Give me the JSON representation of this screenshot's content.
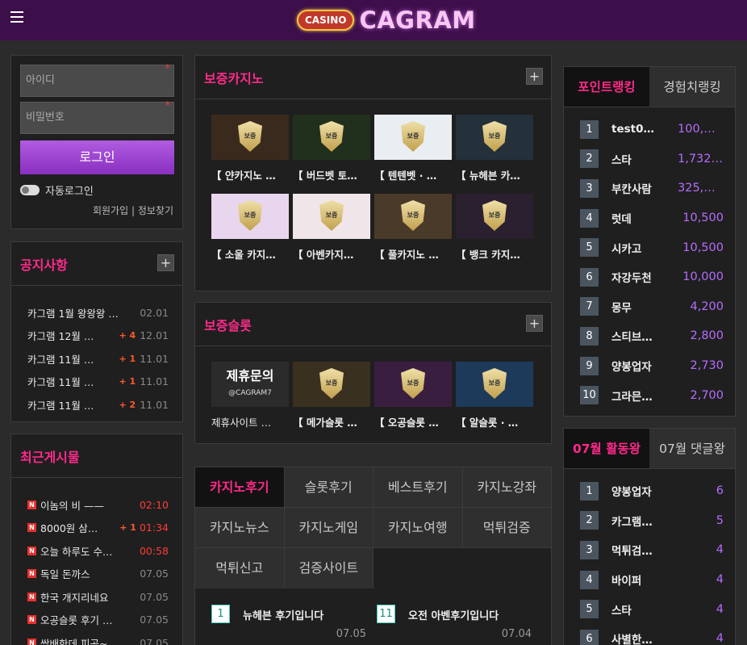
{
  "header": {
    "logo_badge": "CASINO",
    "logo_text": "CAGRAM"
  },
  "login": {
    "id_placeholder": "아이디",
    "pw_placeholder": "비밀번호",
    "required_mark": "*",
    "login_label": "로그인",
    "auto_login": "자동로그인",
    "signup": "회원가입",
    "separator": "|",
    "find_info": "정보찾기"
  },
  "notice": {
    "title": "공지사항",
    "plus": "+",
    "items": [
      {
        "title": "카그램 1월 왕왕왕 …",
        "count": "",
        "date": "02.01"
      },
      {
        "title": "카그램 12월 …",
        "count": "+ 4",
        "date": "12.01"
      },
      {
        "title": "카그램 11월 …",
        "count": "+ 1",
        "date": "11.01"
      },
      {
        "title": "카그램 11월 …",
        "count": "+ 1",
        "date": "11.01"
      },
      {
        "title": "카그램 11월 …",
        "count": "+ 2",
        "date": "11.01"
      }
    ]
  },
  "recent": {
    "title": "최근게시물",
    "badge": "N",
    "items": [
      {
        "title": "이놈의 비 ——",
        "count": "",
        "date": "02:10"
      },
      {
        "title": "8000원 삼…",
        "count": "+ 1",
        "date": "01:34"
      },
      {
        "title": "오늘 하루도 수…",
        "count": "",
        "date": "00:58"
      },
      {
        "title": "독일 돈까스",
        "count": "",
        "date": "07.05"
      },
      {
        "title": "한국 개지리네요",
        "count": "",
        "date": "07.05"
      },
      {
        "title": "오공슬롯 후기 …",
        "count": "",
        "date": "07.05"
      },
      {
        "title": "쌈배한데 피곤~",
        "count": "",
        "date": "07.05"
      }
    ]
  },
  "guarantee_casino": {
    "title": "보증카지노",
    "plus": "+",
    "items": [
      {
        "label": "【 얀카지노 …",
        "bg": "#3a2a1e"
      },
      {
        "label": "【 버드벳 토…",
        "bg": "#20301c"
      },
      {
        "label": "【 텐텐벳 · …",
        "bg": "#e8eef2"
      },
      {
        "label": "【 뉴헤븐 카…",
        "bg": "#24303a"
      },
      {
        "label": "【 소울 카지…",
        "bg": "#e8d6ee"
      },
      {
        "label": "【 아벤카지…",
        "bg": "#f0e6ea"
      },
      {
        "label": "【 풀카지노 …",
        "bg": "#4a3a2a"
      },
      {
        "label": "【 뱅크 카지…",
        "bg": "#2a2030"
      }
    ]
  },
  "guarantee_slot": {
    "title": "보증슬롯",
    "plus": "+",
    "items": [
      {
        "label": "제휴사이트 …",
        "bg": "#2b2b2b",
        "banner": "제휴문의",
        "sub": "@CAGRAM7"
      },
      {
        "label": "【 메가슬롯 …",
        "bg": "#3a3020"
      },
      {
        "label": "【 오공슬롯 …",
        "bg": "#3a1e40"
      },
      {
        "label": "【 알슬롯 · …",
        "bg": "#1e3a5a"
      }
    ]
  },
  "review_tabs": {
    "rows": [
      [
        "카지노후기",
        "슬롯후기",
        "베스트후기",
        "카지노강좌"
      ],
      [
        "카지노뉴스",
        "카지노게임",
        "카지노여행",
        "먹튀검증"
      ],
      [
        "먹튀신고",
        "검증사이트"
      ]
    ],
    "active": "카지노후기"
  },
  "reviews": [
    {
      "num": "1",
      "title": "뉴헤븐 후기입니다",
      "date": "07.05"
    },
    {
      "num": "11",
      "title": "오전 아벤후기입니다",
      "date": "07.04"
    }
  ],
  "point_rank": {
    "tabs": [
      "포인트랭킹",
      "경험치랭킹"
    ],
    "items": [
      {
        "num": "1",
        "name": "test0…",
        "value": "100,…"
      },
      {
        "num": "2",
        "name": "스타",
        "value": "1,732…"
      },
      {
        "num": "3",
        "name": "부칸사람",
        "value": "325,…"
      },
      {
        "num": "4",
        "name": "럿데",
        "value": "10,500"
      },
      {
        "num": "5",
        "name": "시카고",
        "value": "10,500"
      },
      {
        "num": "6",
        "name": "자강두천",
        "value": "10,000"
      },
      {
        "num": "7",
        "name": "몽무",
        "value": "4,200"
      },
      {
        "num": "8",
        "name": "스티브…",
        "value": "2,800"
      },
      {
        "num": "9",
        "name": "양봉업자",
        "value": "2,730"
      },
      {
        "num": "10",
        "name": "그라믄…",
        "value": "2,700"
      }
    ]
  },
  "activity_rank": {
    "tabs": [
      "07월 활동왕",
      "07월 댓글왕"
    ],
    "items": [
      {
        "num": "1",
        "name": "양봉업자",
        "value": "6"
      },
      {
        "num": "2",
        "name": "카그램…",
        "value": "5"
      },
      {
        "num": "3",
        "name": "먹튀검…",
        "value": "4"
      },
      {
        "num": "4",
        "name": "바이퍼",
        "value": "4"
      },
      {
        "num": "5",
        "name": "스타",
        "value": "4"
      },
      {
        "num": "6",
        "name": "사별한…",
        "value": "4"
      }
    ]
  },
  "colors": {
    "accent": "#ff2a8a",
    "purple": "#b66cff",
    "header": "#3d0f4a"
  }
}
